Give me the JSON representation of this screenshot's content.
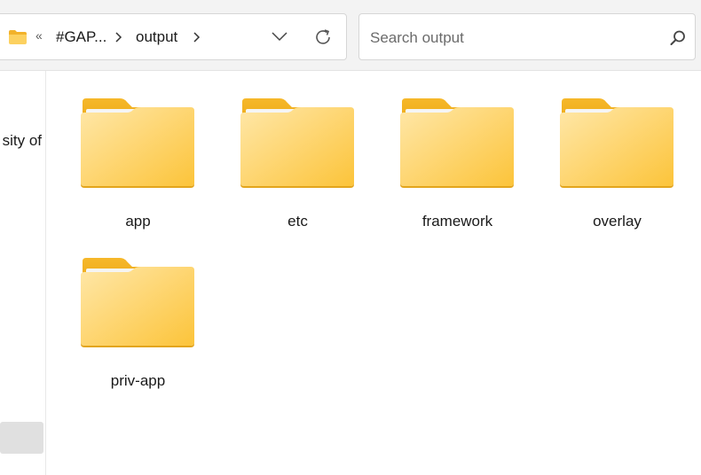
{
  "address_bar": {
    "overflow_glyph": "«",
    "crumbs": [
      "#GAP...",
      "output"
    ]
  },
  "search": {
    "placeholder": "Search output"
  },
  "nav": {
    "partial_item": "sity of"
  },
  "folders": [
    {
      "name": "app"
    },
    {
      "name": "etc"
    },
    {
      "name": "framework"
    },
    {
      "name": "overlay"
    },
    {
      "name": "priv-app"
    }
  ],
  "colors": {
    "folder_back": "#f5b923",
    "folder_front_top": "#ffe39a",
    "folder_front_bottom": "#fcc63b",
    "paper": "#f4f4f4"
  },
  "icons": [
    "folder-icon",
    "chevron-right-icon",
    "chevron-down-icon",
    "refresh-icon",
    "search-icon"
  ]
}
